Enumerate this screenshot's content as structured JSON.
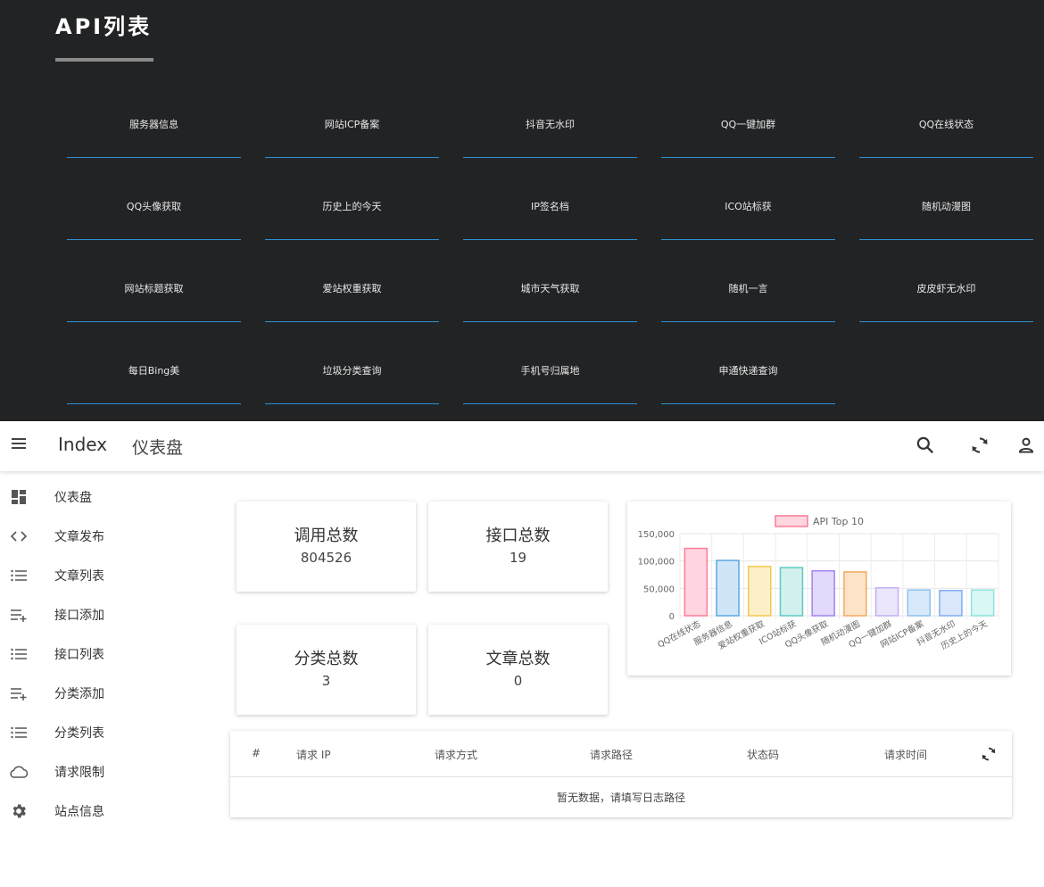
{
  "api_section": {
    "title": "API列表",
    "items": [
      "服务器信息",
      "网站ICP备案",
      "抖音无水印",
      "QQ一键加群",
      "QQ在线状态",
      "QQ头像获取",
      "历史上的今天",
      "IP签名档",
      "ICO站标获",
      "随机动漫图",
      "网站标题获取",
      "爱站权重获取",
      "城市天气获取",
      "随机一言",
      "皮皮虾无水印",
      "每日Bing美",
      "垃圾分类查询",
      "手机号归属地",
      "申通快递查询"
    ]
  },
  "appbar": {
    "title": "Index",
    "subtitle": "仪表盘",
    "icons": [
      "search-icon",
      "sync-icon",
      "account-icon"
    ]
  },
  "sidebar": {
    "items": [
      {
        "label": "仪表盘",
        "icon": "dashboard-icon"
      },
      {
        "label": "文章发布",
        "icon": "code-icon"
      },
      {
        "label": "文章列表",
        "icon": "list-icon"
      },
      {
        "label": "接口添加",
        "icon": "playlist-add-icon"
      },
      {
        "label": "接口列表",
        "icon": "list-icon"
      },
      {
        "label": "分类添加",
        "icon": "playlist-add-icon"
      },
      {
        "label": "分类列表",
        "icon": "list-icon"
      },
      {
        "label": "请求限制",
        "icon": "cloud-icon"
      },
      {
        "label": "站点信息",
        "icon": "gear-icon"
      }
    ]
  },
  "stats": {
    "calls": {
      "label": "调用总数",
      "value": "804526"
    },
    "apis": {
      "label": "接口总数",
      "value": "19"
    },
    "categories": {
      "label": "分类总数",
      "value": "3"
    },
    "articles": {
      "label": "文章总数",
      "value": "0"
    }
  },
  "chart_data": {
    "type": "bar",
    "legend": "API Top 10",
    "categories": [
      "QQ在线状态",
      "服务器信息",
      "爱站权重获取",
      "ICO站标获",
      "QQ头像获取",
      "随机动漫图",
      "QQ一键加群",
      "网站ICP备案",
      "抖音无水印",
      "历史上的今天"
    ],
    "values": [
      123000,
      101000,
      90000,
      88000,
      82000,
      80000,
      51000,
      47000,
      46000,
      47000
    ],
    "ylim": [
      0,
      150000
    ],
    "yticks": [
      "150,000",
      "100,000",
      "50,000",
      "0"
    ],
    "grid": true,
    "colors": [
      {
        "fill": "#ffd6df",
        "stroke": "#ff7a99"
      },
      {
        "fill": "#cfe6f8",
        "stroke": "#5ba8e0"
      },
      {
        "fill": "#fdf0c8",
        "stroke": "#f2c94c"
      },
      {
        "fill": "#d2f0ee",
        "stroke": "#5ccbc0"
      },
      {
        "fill": "#e3d9fb",
        "stroke": "#a184f2"
      },
      {
        "fill": "#fde3c8",
        "stroke": "#f6a95a"
      },
      {
        "fill": "#ece6fb",
        "stroke": "#c2b0f0"
      },
      {
        "fill": "#d7e9fb",
        "stroke": "#8fc1ef"
      },
      {
        "fill": "#dbe8fb",
        "stroke": "#7eaef0"
      },
      {
        "fill": "#d9f7f5",
        "stroke": "#8fe3dc"
      }
    ]
  },
  "table": {
    "headers": [
      "#",
      "请求 IP",
      "请求方式",
      "请求路径",
      "状态码",
      "请求时间"
    ],
    "empty": "暂无数据，请填写日志路径"
  }
}
